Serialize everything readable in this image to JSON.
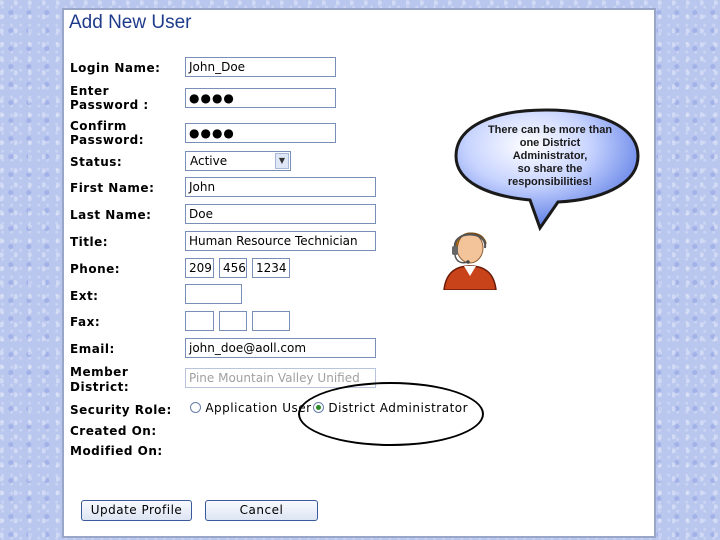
{
  "form": {
    "title": "Add New User",
    "labels": {
      "login_name": "Login Name:",
      "enter_password_1": "Enter",
      "enter_password_2": "Password :",
      "confirm_password_1": "Confirm",
      "confirm_password_2": "Password:",
      "status": "Status:",
      "first_name": "First Name:",
      "last_name": "Last Name:",
      "title": "Title:",
      "phone": "Phone:",
      "ext": "Ext:",
      "fax": "Fax:",
      "email": "Email:",
      "member_district_1": "Member",
      "member_district_2": "District:",
      "security_role": "Security Role:",
      "created_on": "Created On:",
      "modified_on": "Modified On:"
    },
    "values": {
      "login_name": "John_Doe",
      "password": "●●●●",
      "confirm_password": "●●●●",
      "status": "Active",
      "first_name": "John",
      "last_name": "Doe",
      "title": "Human Resource Technician",
      "phone_area": "209",
      "phone_prefix": "456",
      "phone_line": "1234",
      "ext": "",
      "fax_area": "",
      "fax_prefix": "",
      "fax_line": "",
      "email": "john_doe@aoll.com",
      "member_district": "Pine Mountain Valley Unified"
    },
    "security_role": {
      "options": [
        "Application User",
        "District Administrator"
      ],
      "selected": "District Administrator"
    },
    "buttons": {
      "update": "Update Profile",
      "cancel": "Cancel"
    }
  },
  "callout": {
    "line1": "There can be more than",
    "line2": "one District",
    "line3": "Administrator,",
    "line4": "so share the",
    "line5": "responsibilities!"
  },
  "colors": {
    "title": "#1f3b8c",
    "field_border": "#7a8fb8",
    "bubble": "#5a78e0",
    "background": "#b9c6ee"
  }
}
